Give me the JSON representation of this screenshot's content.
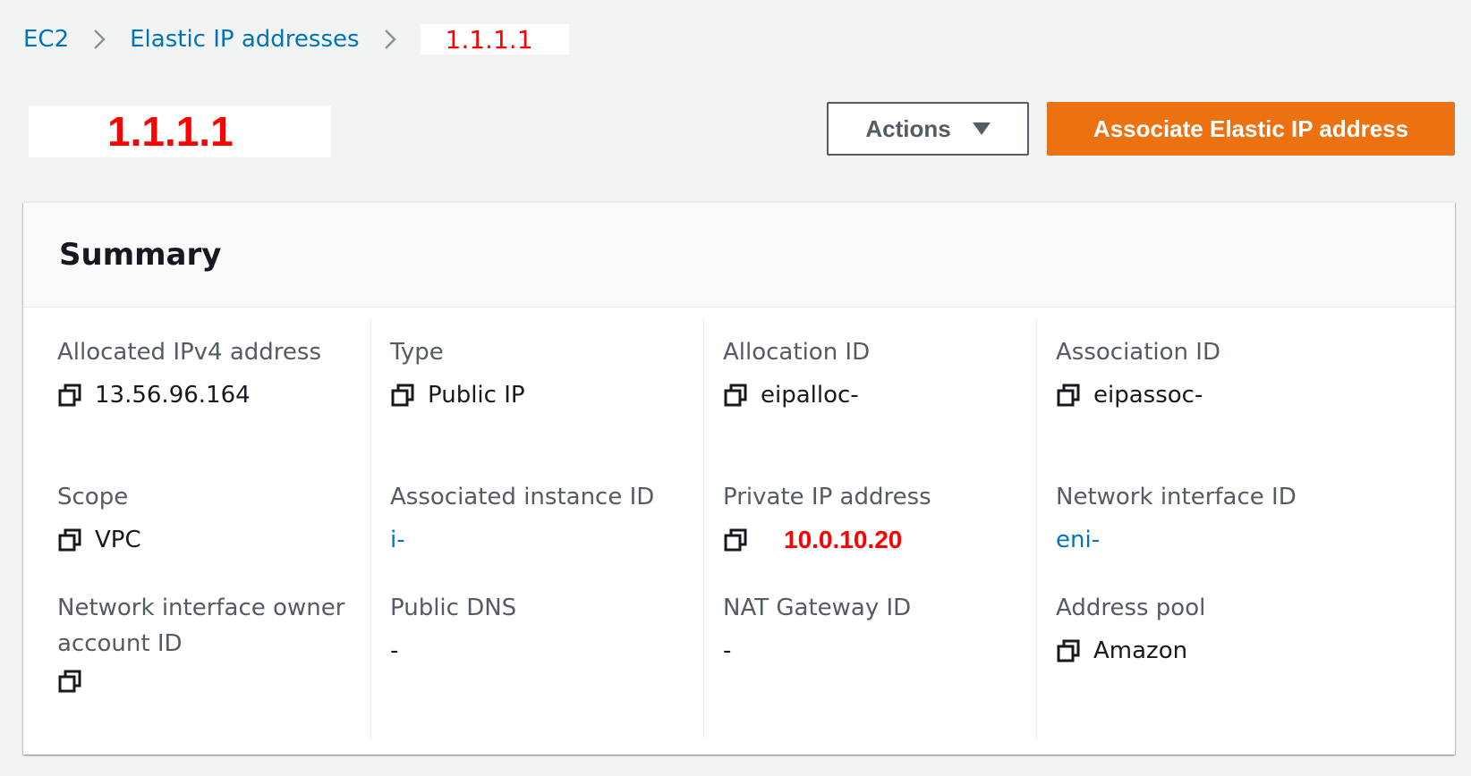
{
  "breadcrumb": {
    "root": "EC2",
    "section": "Elastic IP addresses",
    "current": "1.1.1.1"
  },
  "header": {
    "title": "1.1.1.1",
    "actions_label": "Actions",
    "primary_label": "Associate Elastic IP address"
  },
  "summary": {
    "title": "Summary",
    "fields": {
      "allocated_ipv4": {
        "label": "Allocated IPv4 address",
        "value": "13.56.96.164"
      },
      "type": {
        "label": "Type",
        "value": "Public IP"
      },
      "allocation_id": {
        "label": "Allocation ID",
        "value": "eipalloc-"
      },
      "association_id": {
        "label": "Association ID",
        "value": "eipassoc-"
      },
      "scope": {
        "label": "Scope",
        "value": "VPC"
      },
      "associated_instance": {
        "label": "Associated instance ID",
        "value": "i-"
      },
      "private_ip": {
        "label": "Private IP address",
        "value": "10.0.10.20"
      },
      "network_interface": {
        "label": "Network interface ID",
        "value": "eni-"
      },
      "owner_account_label_line1": "Network interface owner",
      "owner_account_label_line2": "account ID",
      "public_dns": {
        "label": "Public DNS",
        "value": "-"
      },
      "nat_gateway": {
        "label": "NAT Gateway ID",
        "value": "-"
      },
      "address_pool": {
        "label": "Address pool",
        "value": "Amazon"
      }
    }
  },
  "colors": {
    "link": "#0073bb",
    "primary": "#ec7211",
    "redacted_text": "#ff0000"
  }
}
